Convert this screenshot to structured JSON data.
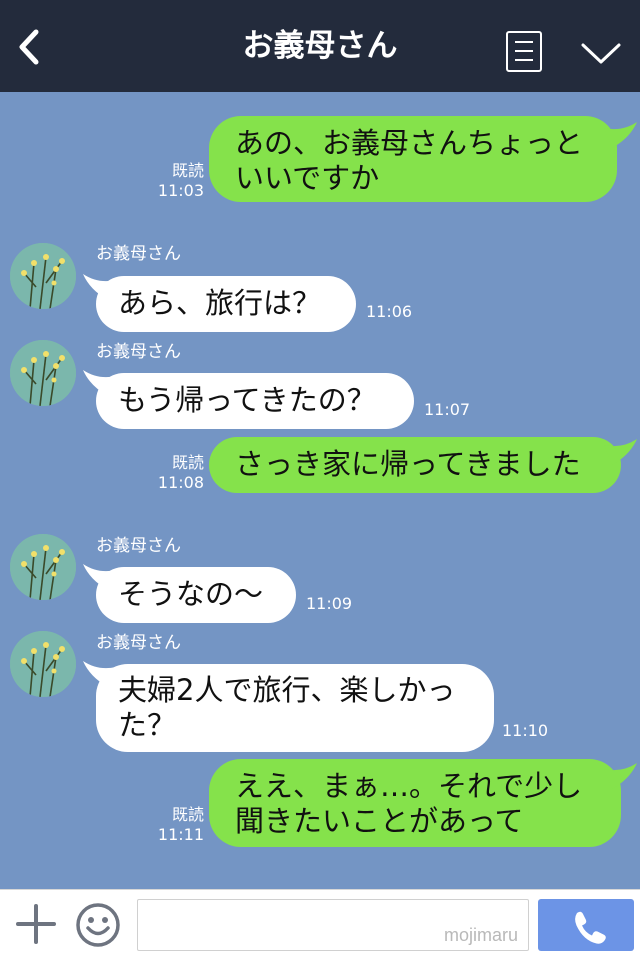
{
  "header": {
    "title": "お義母さん",
    "back_icon": "chevron-left-icon",
    "menu_icon": "list-icon",
    "expand_icon": "chevron-down-icon"
  },
  "messages": [
    {
      "side": "me",
      "lines": [
        "あの、お義母さんちょっと",
        "いいですか"
      ],
      "read": "既読",
      "time": "11:03"
    },
    {
      "side": "them",
      "sender": "お義母さん",
      "lines": [
        "あら、旅行は？"
      ],
      "time": "11:06"
    },
    {
      "side": "them",
      "sender": "お義母さん",
      "lines": [
        "もう帰ってきたの？"
      ],
      "time": "11:07"
    },
    {
      "side": "me",
      "lines": [
        "さっき家に帰ってきました"
      ],
      "read": "既読",
      "time": "11:08"
    },
    {
      "side": "them",
      "sender": "お義母さん",
      "lines": [
        "そうなの〜"
      ],
      "time": "11:09"
    },
    {
      "side": "them",
      "sender": "お義母さん",
      "lines": [
        "夫婦2人で旅行、楽しかっ",
        "た？"
      ],
      "time": "11:10"
    },
    {
      "side": "me",
      "lines": [
        "ええ、まぁ…。それで少し",
        "聞きたいことがあって"
      ],
      "read": "既読",
      "time": "11:11"
    }
  ],
  "footer": {
    "plus_icon": "plus-icon",
    "emoji_icon": "smiley-icon",
    "input_value": "",
    "watermark": "mojimaru",
    "call_icon": "phone-icon"
  },
  "colors": {
    "header_bg": "#232b3c",
    "chat_bg": "#7495c4",
    "my_bubble": "#85e24b",
    "their_bubble": "#ffffff",
    "call_button": "#6c94e6"
  }
}
